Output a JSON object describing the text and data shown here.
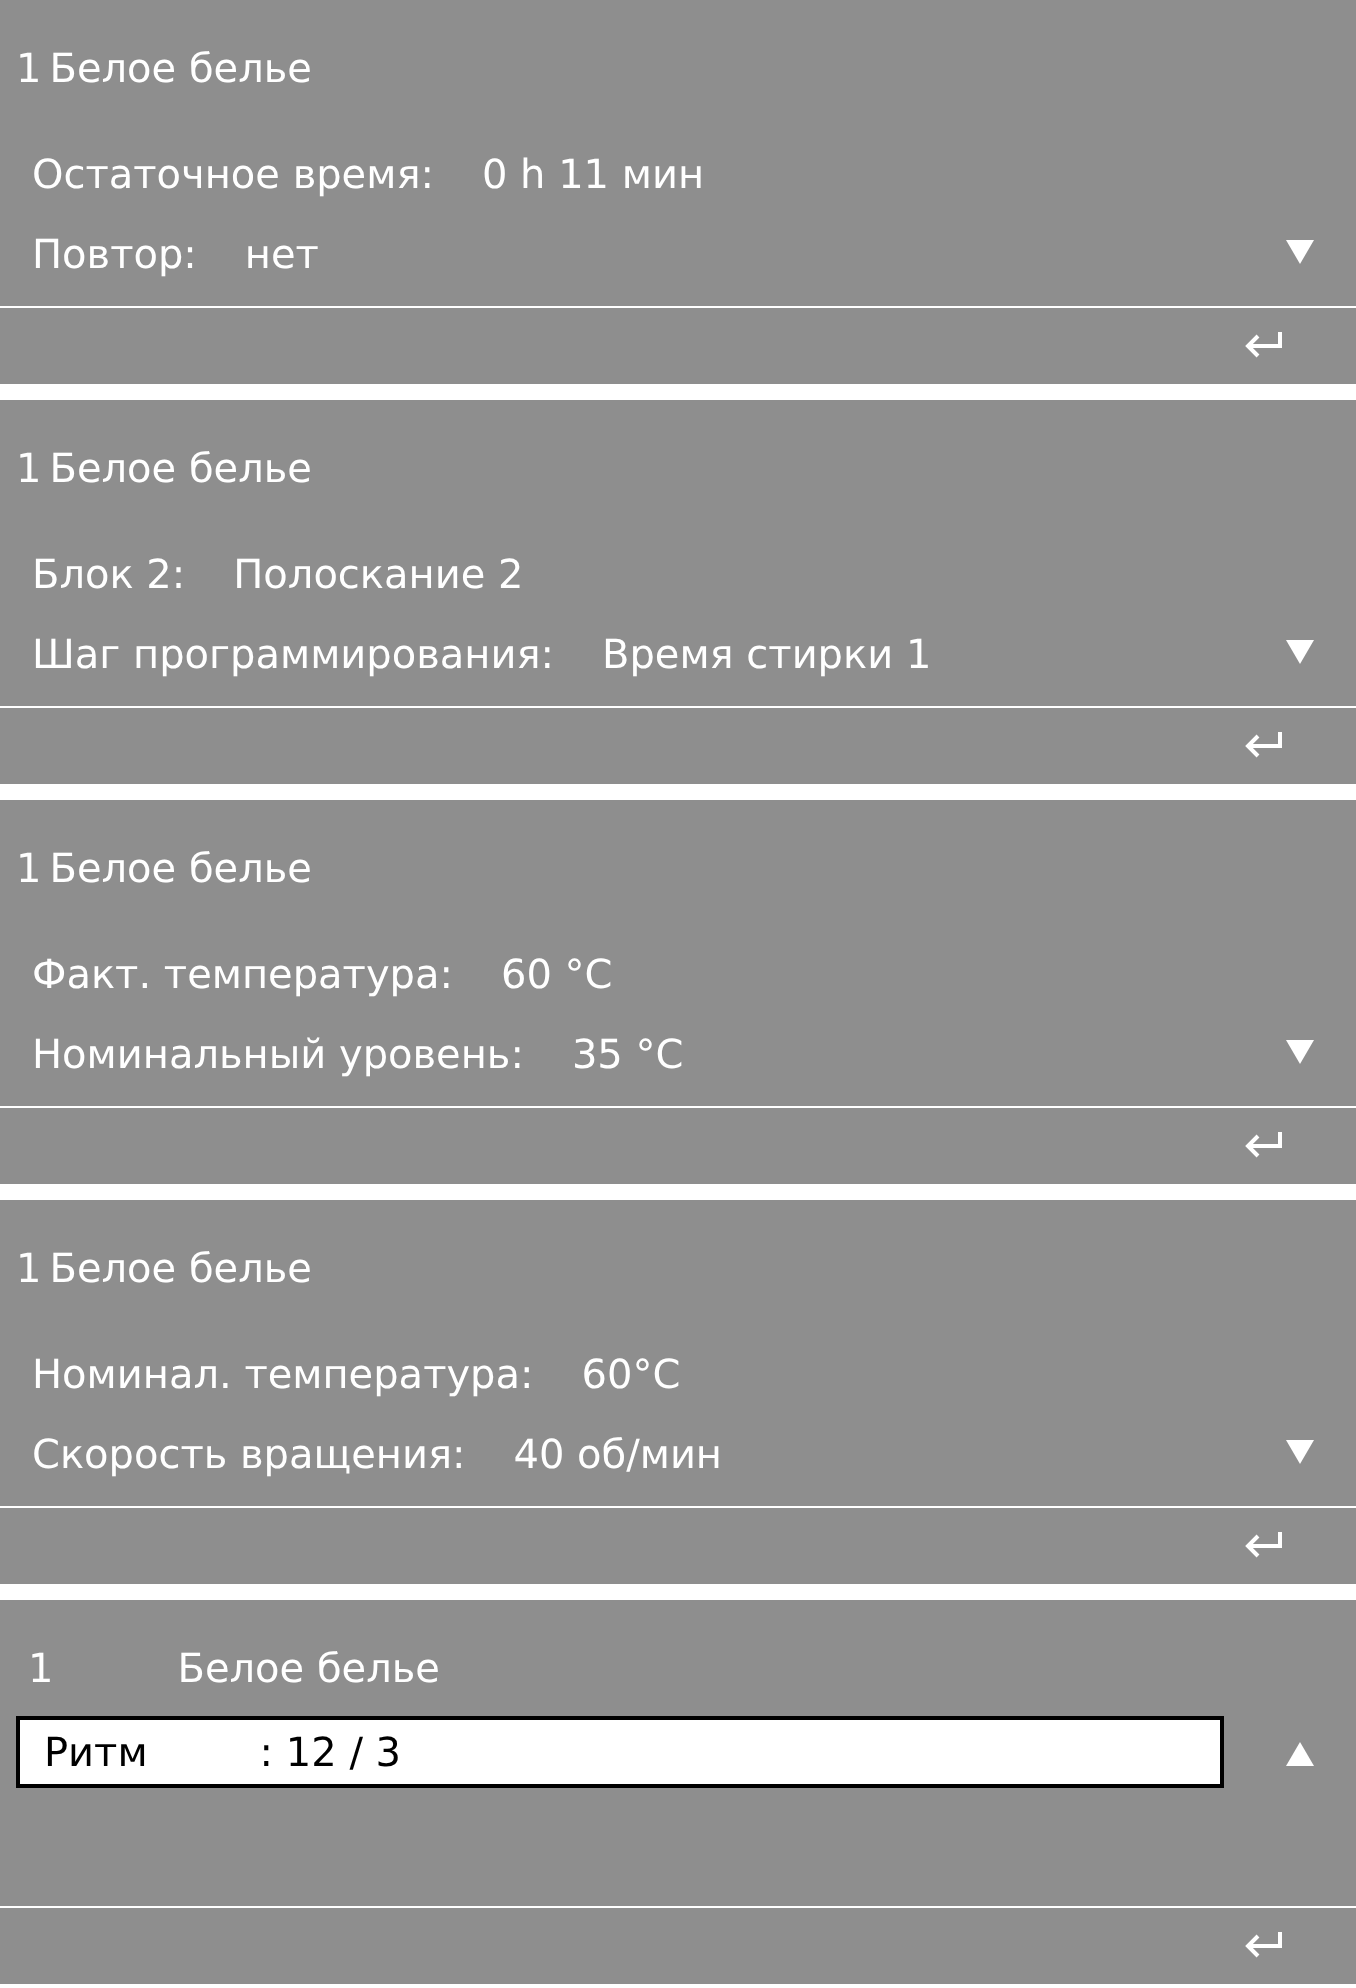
{
  "screens": [
    {
      "kind": "status",
      "title": {
        "number": "1",
        "name": "Белое белье"
      },
      "rows": [
        {
          "label": "Остаточное время:",
          "value": "0 h 11 мин",
          "selected": false
        },
        {
          "label": "Повтор:",
          "value": "нет",
          "selected": false
        }
      ],
      "scroll_up": false
    },
    {
      "kind": "status",
      "title": {
        "number": "1",
        "name": "Белое белье"
      },
      "rows": [
        {
          "label": "Блок 2:",
          "value": "Полоскание 2",
          "selected": false
        },
        {
          "label": "Шаг программирования:",
          "value": "Время стирки 1",
          "selected": false
        }
      ],
      "scroll_up": false
    },
    {
      "kind": "status",
      "title": {
        "number": "1",
        "name": "Белое белье"
      },
      "rows": [
        {
          "label": "Факт. температура:",
          "value": "60 °C",
          "selected": false
        },
        {
          "label": "Номинальный уровень:",
          "value": "35 °C",
          "selected": false
        }
      ],
      "scroll_up": false
    },
    {
      "kind": "status",
      "title": {
        "number": "1",
        "name": "Белое белье"
      },
      "rows": [
        {
          "label": "Номинал. температура:",
          "value": "60°C",
          "selected": false
        },
        {
          "label": "Скорость вращения:",
          "value": "40 об/мин",
          "selected": false
        }
      ],
      "scroll_up": false
    },
    {
      "kind": "edit",
      "title": {
        "number": "1",
        "name": "Белое белье"
      },
      "rows": [
        {
          "label": "Ритм",
          "value": ": 12 / 3",
          "selected": true
        }
      ],
      "scroll_up": true
    }
  ]
}
